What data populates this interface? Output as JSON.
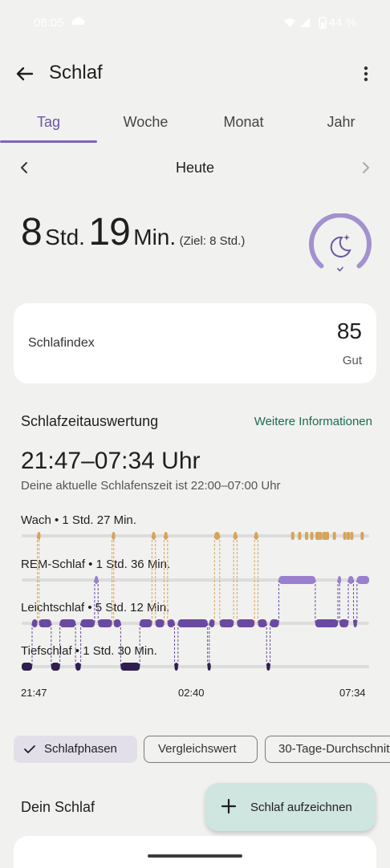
{
  "status_bar": {
    "time": "08:05",
    "battery": "44 %"
  },
  "app_bar": {
    "title": "Schlaf"
  },
  "tabs": [
    {
      "label": "Tag",
      "active": true
    },
    {
      "label": "Woche",
      "active": false
    },
    {
      "label": "Monat",
      "active": false
    },
    {
      "label": "Jahr",
      "active": false
    }
  ],
  "date_nav": {
    "label": "Heute"
  },
  "duration": {
    "hours": "8",
    "hours_unit": "Std.",
    "minutes": "19",
    "minutes_unit": "Min.",
    "goal": "(Ziel: 8 Std.)",
    "goal_progress": 1.0
  },
  "score_card": {
    "label": "Schlafindex",
    "score": "85",
    "rating": "Gut"
  },
  "analysis": {
    "title": "Schlafzeitauswertung",
    "more_link": "Weitere Informationen",
    "range": "21:47–07:34 Uhr",
    "schedule_note": "Deine aktuelle Schlafenszeit ist 22:00–07:00 Uhr"
  },
  "chart_data": {
    "type": "hypnogram",
    "x_start": "21:47",
    "x_end": "07:34",
    "tick_labels": [
      "21:47",
      "02:40",
      "07:34"
    ],
    "stages": [
      {
        "name": "Wach",
        "summary": "Wach • 1 Std. 27 Min.",
        "color": "#d6a35c"
      },
      {
        "name": "REM-Schlaf",
        "summary": "REM-Schlaf • 1 Std. 36 Min.",
        "color": "#9b7fcf"
      },
      {
        "name": "Leichtschlaf",
        "summary": "Leichtschlaf • 5 Std. 12 Min.",
        "color": "#6a4aa0"
      },
      {
        "name": "Tiefschlaf",
        "summary": "Tiefschlaf • 1 Std. 30 Min.",
        "color": "#2f1e4f"
      }
    ],
    "segments": [
      {
        "stage": 3,
        "start": 0.0,
        "end": 0.03
      },
      {
        "stage": 2,
        "start": 0.03,
        "end": 0.045
      },
      {
        "stage": 0,
        "start": 0.045,
        "end": 0.05
      },
      {
        "stage": 2,
        "start": 0.05,
        "end": 0.085
      },
      {
        "stage": 3,
        "start": 0.085,
        "end": 0.11
      },
      {
        "stage": 2,
        "start": 0.11,
        "end": 0.155
      },
      {
        "stage": 3,
        "start": 0.155,
        "end": 0.17
      },
      {
        "stage": 2,
        "start": 0.17,
        "end": 0.21
      },
      {
        "stage": 1,
        "start": 0.21,
        "end": 0.22
      },
      {
        "stage": 2,
        "start": 0.22,
        "end": 0.26
      },
      {
        "stage": 0,
        "start": 0.26,
        "end": 0.265
      },
      {
        "stage": 2,
        "start": 0.265,
        "end": 0.285
      },
      {
        "stage": 3,
        "start": 0.285,
        "end": 0.34
      },
      {
        "stage": 2,
        "start": 0.34,
        "end": 0.375
      },
      {
        "stage": 0,
        "start": 0.375,
        "end": 0.385
      },
      {
        "stage": 2,
        "start": 0.385,
        "end": 0.41
      },
      {
        "stage": 0,
        "start": 0.41,
        "end": 0.42
      },
      {
        "stage": 2,
        "start": 0.42,
        "end": 0.44
      },
      {
        "stage": 3,
        "start": 0.44,
        "end": 0.45
      },
      {
        "stage": 2,
        "start": 0.45,
        "end": 0.535
      },
      {
        "stage": 3,
        "start": 0.535,
        "end": 0.54
      },
      {
        "stage": 2,
        "start": 0.54,
        "end": 0.555
      },
      {
        "stage": 0,
        "start": 0.555,
        "end": 0.57
      },
      {
        "stage": 2,
        "start": 0.57,
        "end": 0.61
      },
      {
        "stage": 0,
        "start": 0.61,
        "end": 0.62
      },
      {
        "stage": 2,
        "start": 0.62,
        "end": 0.67
      },
      {
        "stage": 0,
        "start": 0.67,
        "end": 0.68
      },
      {
        "stage": 2,
        "start": 0.68,
        "end": 0.705
      },
      {
        "stage": 3,
        "start": 0.705,
        "end": 0.715
      },
      {
        "stage": 2,
        "start": 0.715,
        "end": 0.74
      },
      {
        "stage": 1,
        "start": 0.74,
        "end": 0.845
      },
      {
        "stage": 2,
        "start": 0.845,
        "end": 0.91
      },
      {
        "stage": 1,
        "start": 0.91,
        "end": 0.915
      },
      {
        "stage": 2,
        "start": 0.915,
        "end": 0.94
      },
      {
        "stage": 1,
        "start": 0.94,
        "end": 0.955
      },
      {
        "stage": 2,
        "start": 0.955,
        "end": 0.965
      },
      {
        "stage": 1,
        "start": 0.965,
        "end": 1.0
      }
    ],
    "wake_marks": [
      0.78,
      0.8,
      0.82,
      0.835,
      0.85,
      0.855,
      0.86,
      0.87,
      0.875,
      0.88,
      0.9,
      0.93,
      0.94,
      0.95,
      0.98
    ]
  },
  "chips": [
    {
      "label": "Schlafphasen",
      "selected": true
    },
    {
      "label": "Vergleichswert",
      "selected": false
    },
    {
      "label": "30-Tage-Durchschnitt",
      "selected": false
    }
  ],
  "your_sleep": {
    "title": "Dein Schlaf"
  },
  "fab": {
    "label": "Schlaf aufzeichnen"
  }
}
